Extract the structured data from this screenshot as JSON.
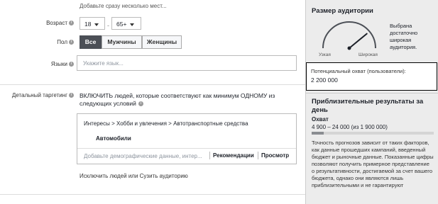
{
  "form": {
    "top_hint": "Добавьте сразу несколько мест...",
    "age": {
      "label": "Возраст",
      "min": "18",
      "separator": "-",
      "max": "65+"
    },
    "gender": {
      "label": "Пол",
      "options": [
        "Все",
        "Мужчины",
        "Женщины"
      ],
      "selected": "Все"
    },
    "languages": {
      "label": "Языки",
      "placeholder": "Укажите язык..."
    },
    "detailed": {
      "label": "Детальный таргетинг",
      "description": "ВКЛЮЧИТЬ людей, которые соответствуют как минимум ОДНОМУ из следующих условий",
      "path": "Интересы > Хобби и увлечения > Автотранспортные средства",
      "item": "Автомобили",
      "search_placeholder": "Добавьте демографические данные, интер...",
      "recommendations": "Рекомендации",
      "browse": "Просмотр"
    },
    "exclude_link": "Исключить людей или Сузить аудиторию"
  },
  "sidebar": {
    "audience_title": "Размер аудитории",
    "gauge_left": "Узкая",
    "gauge_right": "Широкая",
    "gauge_level": 0.78,
    "gauge_description": "Выбрана достаточно широкая аудитория.",
    "potential_label": "Потенциальный охват (пользователи):",
    "potential_value": "2 200 000",
    "estimates_title": "Приблизительные результаты за день",
    "reach_label": "Охват",
    "reach_range": "4 900 – 24 000 (из 1 900 000)",
    "reach_fraction": 0.1,
    "note": "Точность прогнозов зависит от таких факторов, как данные прошедших кампаний, введенный бюджет и рыночные данные. Показанные цифры позволяют получить примерное представление о результативности, достигаемой за счет вашего бюджета, однако они являются лишь приблизительными и не гарантируют"
  },
  "colors": {
    "active_segment": "#4b4f56",
    "sidebar_bg": "#ececec",
    "highlight_border": "#000000"
  }
}
